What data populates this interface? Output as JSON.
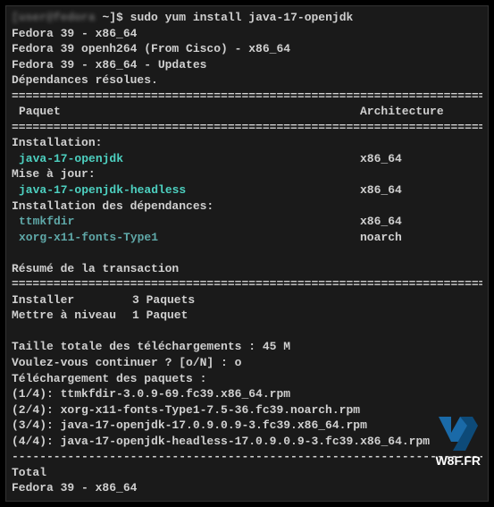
{
  "prompt": {
    "user_host": "[user@fedora",
    "loc": "~]$ ",
    "command": "sudo yum install java-17-openjdk"
  },
  "repos": {
    "line1": "Fedora 39 - x86_64",
    "line2": "Fedora 39 openh264 (From Cisco) - x86_64",
    "line3": "Fedora 39 - x86_64 - Updates",
    "resolved": "Dépendances résolues."
  },
  "divider": "===============================================================================================",
  "header": {
    "pkg": " Paquet",
    "arch": "Architecture"
  },
  "sections": {
    "install": "Installation:",
    "upgrade": "Mise à jour:",
    "deps": "Installation des dépendances:"
  },
  "packages": {
    "p1": {
      "name": "java-17-openjdk",
      "arch": "x86_64"
    },
    "p2": {
      "name": "java-17-openjdk-headless",
      "arch": "x86_64"
    },
    "p3": {
      "name": "ttmkfdir",
      "arch": "x86_64"
    },
    "p4": {
      "name": "xorg-x11-fonts-Type1",
      "arch": "noarch"
    }
  },
  "summary": {
    "title": "Résumé de la transaction",
    "install_label": "Installer",
    "install_val": "3 Paquets",
    "upgrade_label": "Mettre à niveau",
    "upgrade_val": "1 Paquet"
  },
  "download": {
    "total": "Taille totale des téléchargements : 45 M",
    "confirm": "Voulez-vous continuer ? [o/N] : o",
    "heading": "Téléchargement des paquets :",
    "d1": "(1/4): ttmkfdir-3.0.9-69.fc39.x86_64.rpm",
    "d2": "(2/4): xorg-x11-fonts-Type1-7.5-36.fc39.noarch.rpm",
    "d3": "(3/4): java-17-openjdk-17.0.9.0.9-3.fc39.x86_64.rpm",
    "d4": "(4/4): java-17-openjdk-headless-17.0.9.0.9-3.fc39.x86_64.rpm"
  },
  "dash_divider": "-----------------------------------------------------------------------------------------------",
  "footer": {
    "total": "Total",
    "repo": "Fedora 39 - x86_64"
  },
  "watermark": "W8F.FR"
}
